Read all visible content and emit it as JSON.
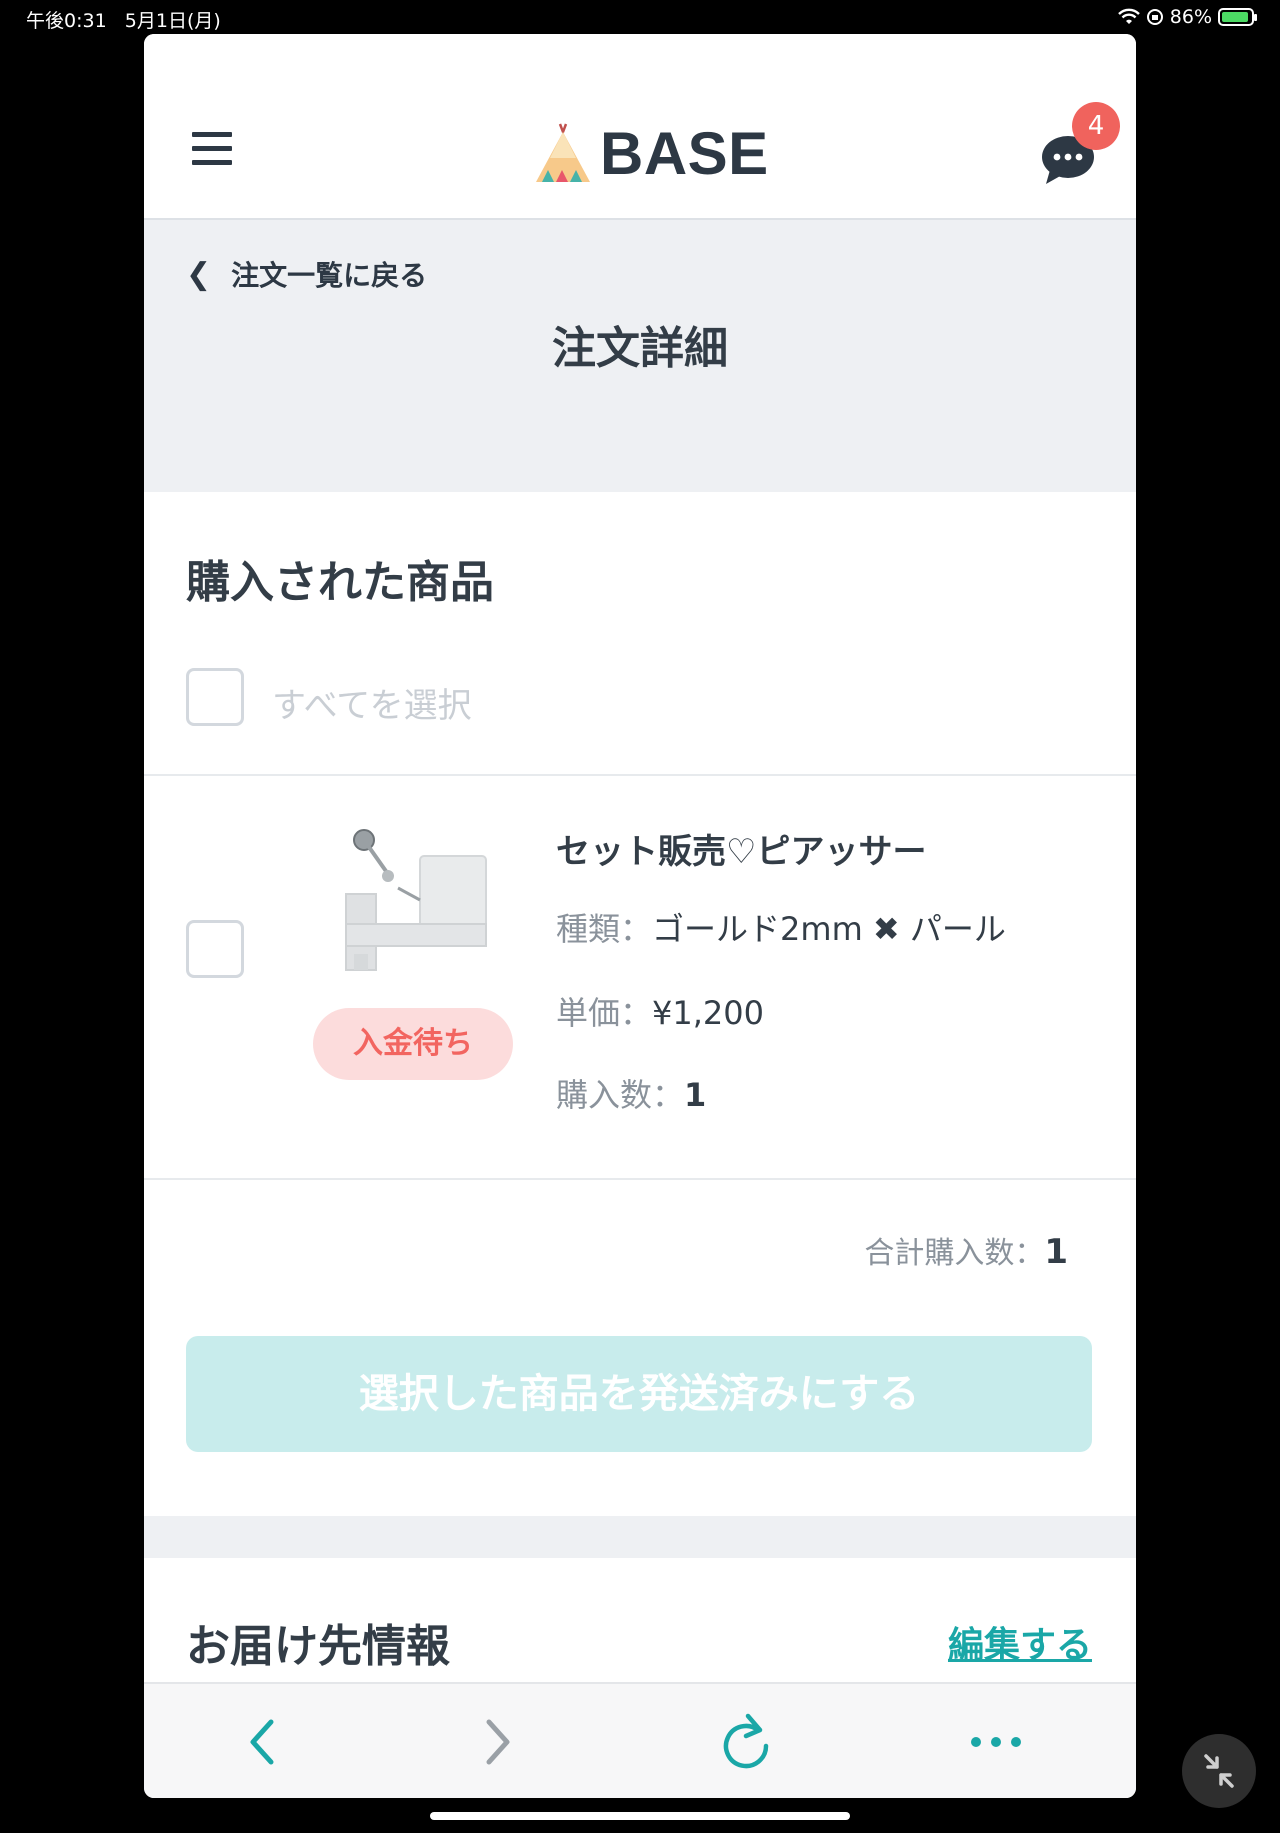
{
  "status_bar": {
    "time": "午後0:31",
    "date": "5月1日(月)",
    "battery": "86%"
  },
  "header": {
    "logo_text": "BASE",
    "chat_badge": "4"
  },
  "subheader": {
    "back_label": "注文一覧に戻る",
    "page_title": "注文詳細"
  },
  "purchased": {
    "section_title": "購入された商品",
    "select_all_label": "すべてを選択",
    "item": {
      "name": "セット販売♡ピアッサー",
      "type_label": "種類",
      "type_value": "ゴールド2mm ✖ パール",
      "price_label": "単価",
      "price_value": "¥1,200",
      "qty_label": "購入数",
      "qty_value": "1",
      "status": "入金待ち"
    },
    "total_label": "合計購入数",
    "total_value": "1",
    "ship_button": "選択した商品を発送済みにする"
  },
  "shipping": {
    "section_title": "お届け先情報",
    "edit_label": "編集する"
  },
  "colors": {
    "accent": "#1aa7a7",
    "ship_button_bg": "#c8ecec",
    "badge": "#f0635d",
    "status_pill_bg": "#fcdcdc",
    "status_pill_text": "#f26560"
  },
  "toolbar_icons": [
    "chevron-left-icon",
    "chevron-right-icon",
    "reload-icon",
    "more-icon"
  ]
}
